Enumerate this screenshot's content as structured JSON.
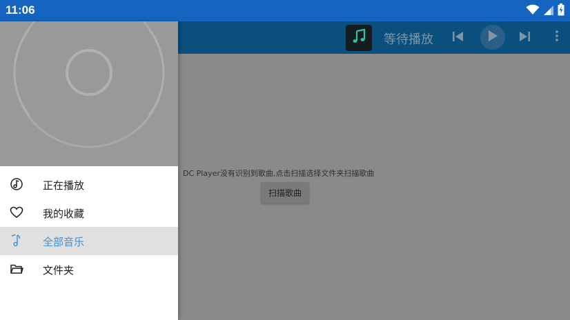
{
  "status_bar": {
    "time": "11:06",
    "icons": [
      "wifi-icon",
      "cellular-signal-icon",
      "battery-charging-icon"
    ]
  },
  "app_bar": {
    "now_playing_title": "等待播放",
    "controls": [
      "previous-icon",
      "play-icon",
      "next-icon",
      "more-vert-icon"
    ]
  },
  "content": {
    "empty_message": "DC Player没有识别到歌曲,点击扫描选择文件夹扫描歌曲",
    "scan_button_label": "扫描歌曲"
  },
  "drawer": {
    "items": [
      {
        "label": "正在播放",
        "icon": "music-disc-icon",
        "active": false
      },
      {
        "label": "我的收藏",
        "icon": "heart-icon",
        "active": false
      },
      {
        "label": "全部音乐",
        "icon": "music-note-icon",
        "active": true
      },
      {
        "label": "文件夹",
        "icon": "folder-icon",
        "active": false
      }
    ]
  },
  "colors": {
    "status_bar": "#1565c0",
    "app_bar_dimmed": "#0b4f7e",
    "scrim_content": "#8a8a8a",
    "accent": "#3d8fd6",
    "active_item_bg": "#e0e0e0",
    "drawer_header": "#999999"
  }
}
